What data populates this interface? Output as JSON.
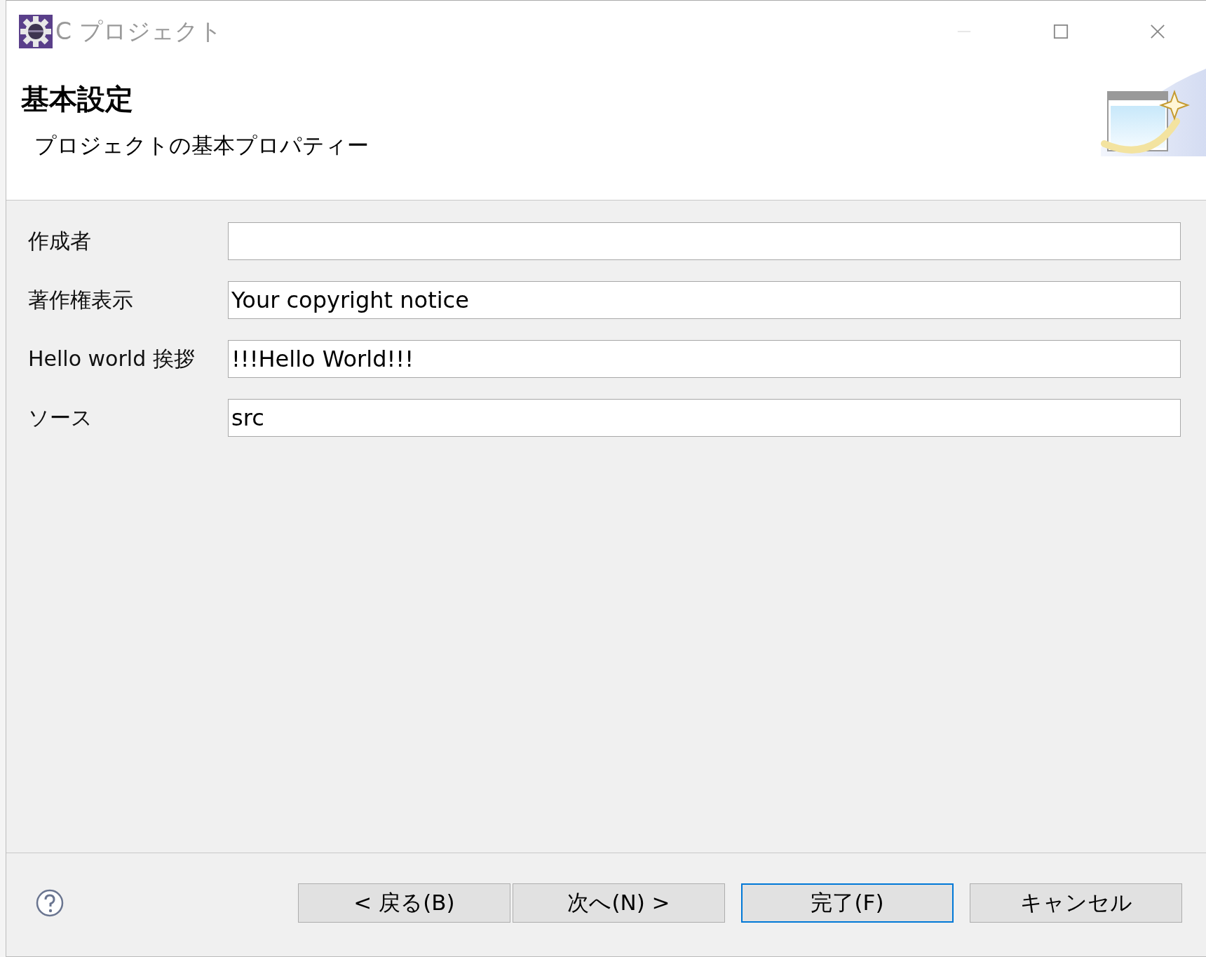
{
  "window": {
    "title": "C プロジェクト",
    "active": false
  },
  "header": {
    "title": "基本設定",
    "description": "プロジェクトの基本プロパティー"
  },
  "fields": [
    {
      "label": "作成者"
    },
    {
      "label": "著作権表示",
      "value": "Your copyright notice"
    },
    {
      "label": "Hello world 挨拶",
      "value": "!!!Hello World!!!"
    },
    {
      "label": "ソース",
      "value": "src"
    }
  ],
  "buttons": [
    {
      "label": "< 戻る(B)",
      "default": false
    },
    {
      "label": "次へ(N) >",
      "default": false
    },
    {
      "label": "完了(F)",
      "default": true
    },
    {
      "label": "キャンセル",
      "default": false
    }
  ]
}
